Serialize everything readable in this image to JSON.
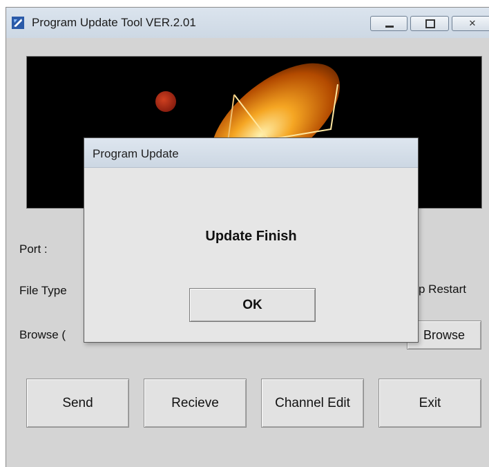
{
  "window": {
    "title": "Program Update Tool VER.2.01",
    "controls": {
      "minimize": "minimize-icon",
      "maximize": "maximize-icon",
      "close": "close-icon"
    }
  },
  "form": {
    "port_label": "Port :",
    "file_type_label": "File Type",
    "restart_label": "p Restart",
    "browse_label": "Browse (",
    "browse_button": "Browse"
  },
  "actions": {
    "send": "Send",
    "receive": "Recieve",
    "channel_edit": "Channel Edit",
    "exit": "Exit"
  },
  "dialog": {
    "title": "Program Update",
    "message": "Update Finish",
    "ok": "OK"
  },
  "colors": {
    "window_bg": "#d4d4d4",
    "banner_bg": "#000000",
    "dish_glow": "#f5a623"
  }
}
